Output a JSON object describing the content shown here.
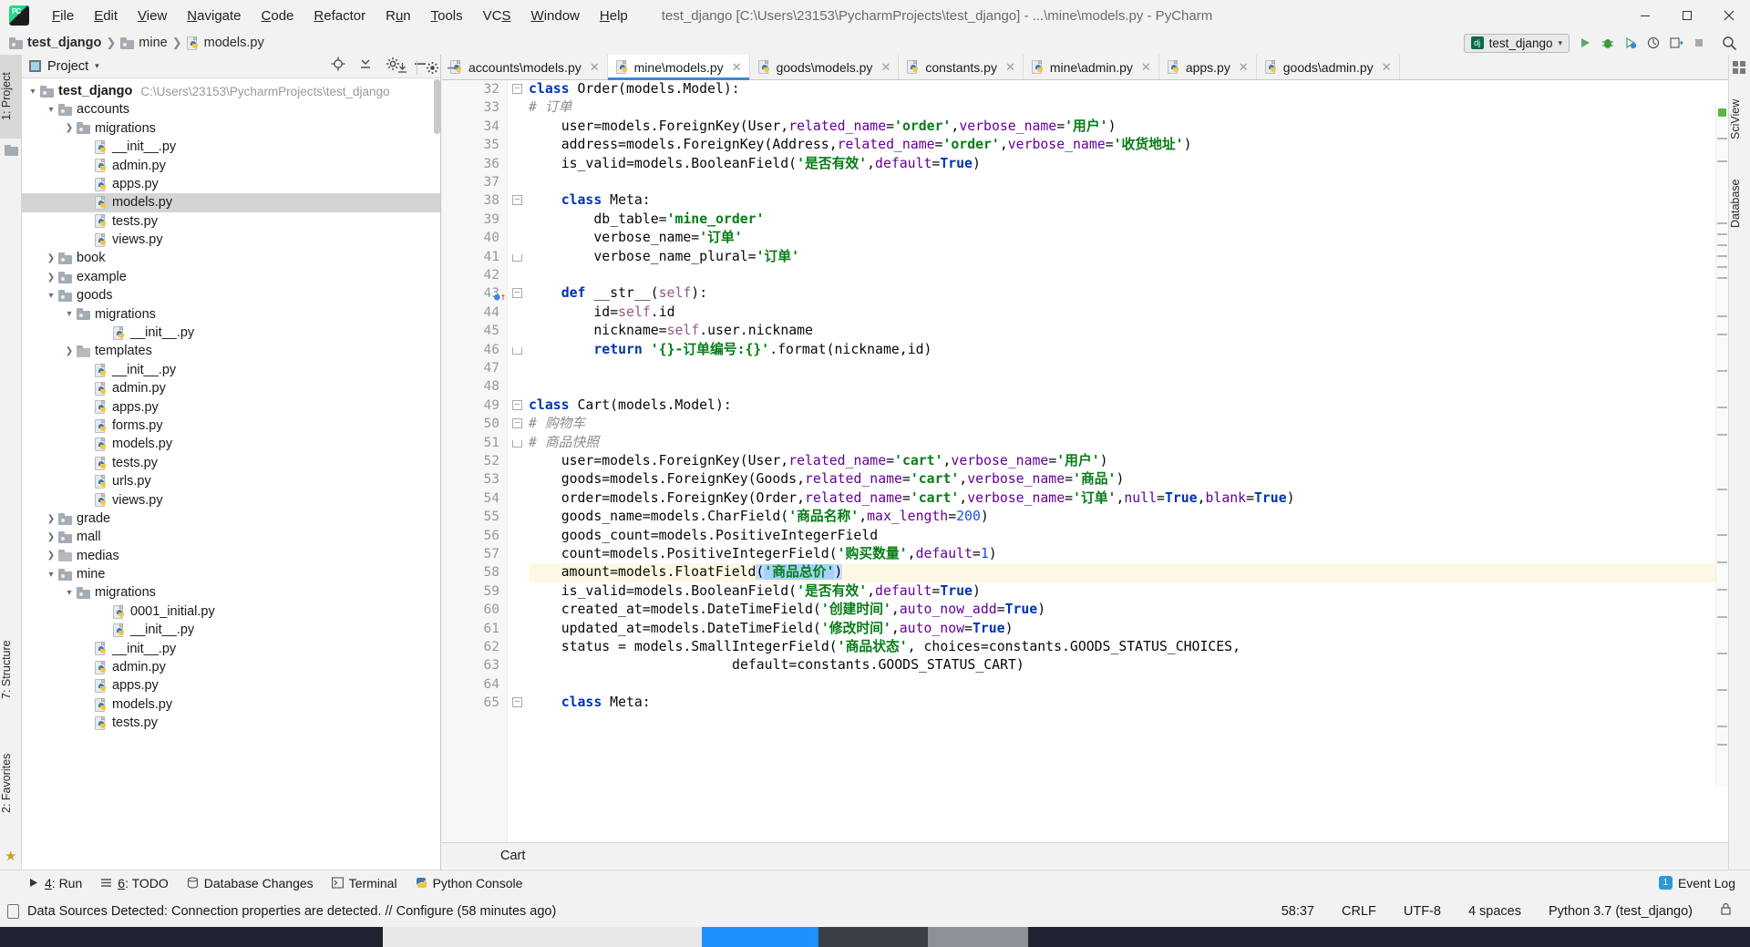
{
  "titlebar": {
    "app_icon": "pycharm-logo",
    "menus": [
      "File",
      "Edit",
      "View",
      "Navigate",
      "Code",
      "Refactor",
      "Run",
      "Tools",
      "VCS",
      "Window",
      "Help"
    ],
    "window_title": "test_django [C:\\Users\\23153\\PycharmProjects\\test_django] - ...\\mine\\models.py - PyCharm",
    "minimize": "–",
    "maximize": "❐",
    "close": "✕"
  },
  "breadcrumb": {
    "items": [
      "test_django",
      "mine",
      "models.py"
    ]
  },
  "toolbar": {
    "run_config": "test_django",
    "run": "▶",
    "debug": "debug-icon",
    "coverage": "coverage-icon",
    "profile": "profile-icon",
    "attach": "attach-icon",
    "stop": "■",
    "search": "search-icon"
  },
  "left_strip": {
    "project_tab": "1: Project",
    "structure_tab": "7: Structure",
    "favorites_tab": "2: Favorites"
  },
  "right_strip": {
    "sciview_tab": "SciView",
    "database_tab": "Database"
  },
  "project_panel": {
    "header_label": "Project",
    "header_caret": "▾",
    "icons": [
      "target-icon",
      "collapse-all-icon",
      "settings-icon",
      "hide-icon"
    ],
    "tree": [
      {
        "depth": 0,
        "arrow": "v",
        "icon": "folder",
        "label": "test_django",
        "bold": true,
        "path": "C:\\Users\\23153\\PycharmProjects\\test_django",
        "selected": false
      },
      {
        "depth": 1,
        "arrow": "v",
        "icon": "folder",
        "label": "accounts",
        "bold": false,
        "path": "",
        "selected": false
      },
      {
        "depth": 2,
        "arrow": ">",
        "icon": "folder",
        "label": "migrations",
        "bold": false,
        "path": "",
        "selected": false
      },
      {
        "depth": 3,
        "arrow": "",
        "icon": "py",
        "label": "__init__.py",
        "bold": false,
        "path": "",
        "selected": false
      },
      {
        "depth": 3,
        "arrow": "",
        "icon": "py",
        "label": "admin.py",
        "bold": false,
        "path": "",
        "selected": false
      },
      {
        "depth": 3,
        "arrow": "",
        "icon": "py",
        "label": "apps.py",
        "bold": false,
        "path": "",
        "selected": false
      },
      {
        "depth": 3,
        "arrow": "",
        "icon": "py",
        "label": "models.py",
        "bold": false,
        "path": "",
        "selected": true
      },
      {
        "depth": 3,
        "arrow": "",
        "icon": "py",
        "label": "tests.py",
        "bold": false,
        "path": "",
        "selected": false
      },
      {
        "depth": 3,
        "arrow": "",
        "icon": "py",
        "label": "views.py",
        "bold": false,
        "path": "",
        "selected": false
      },
      {
        "depth": 1,
        "arrow": ">",
        "icon": "folder",
        "label": "book",
        "bold": false,
        "path": "",
        "selected": false
      },
      {
        "depth": 1,
        "arrow": ">",
        "icon": "folder",
        "label": "example",
        "bold": false,
        "path": "",
        "selected": false
      },
      {
        "depth": 1,
        "arrow": "v",
        "icon": "folder",
        "label": "goods",
        "bold": false,
        "path": "",
        "selected": false
      },
      {
        "depth": 2,
        "arrow": "v",
        "icon": "folder",
        "label": "migrations",
        "bold": false,
        "path": "",
        "selected": false
      },
      {
        "depth": 4,
        "arrow": "",
        "icon": "py",
        "label": "__init__.py",
        "bold": false,
        "path": "",
        "selected": false
      },
      {
        "depth": 2,
        "arrow": ">",
        "icon": "folder-plain",
        "label": "templates",
        "bold": false,
        "path": "",
        "selected": false
      },
      {
        "depth": 3,
        "arrow": "",
        "icon": "py",
        "label": "__init__.py",
        "bold": false,
        "path": "",
        "selected": false
      },
      {
        "depth": 3,
        "arrow": "",
        "icon": "py",
        "label": "admin.py",
        "bold": false,
        "path": "",
        "selected": false
      },
      {
        "depth": 3,
        "arrow": "",
        "icon": "py",
        "label": "apps.py",
        "bold": false,
        "path": "",
        "selected": false
      },
      {
        "depth": 3,
        "arrow": "",
        "icon": "py",
        "label": "forms.py",
        "bold": false,
        "path": "",
        "selected": false
      },
      {
        "depth": 3,
        "arrow": "",
        "icon": "py",
        "label": "models.py",
        "bold": false,
        "path": "",
        "selected": false
      },
      {
        "depth": 3,
        "arrow": "",
        "icon": "py",
        "label": "tests.py",
        "bold": false,
        "path": "",
        "selected": false
      },
      {
        "depth": 3,
        "arrow": "",
        "icon": "py",
        "label": "urls.py",
        "bold": false,
        "path": "",
        "selected": false
      },
      {
        "depth": 3,
        "arrow": "",
        "icon": "py",
        "label": "views.py",
        "bold": false,
        "path": "",
        "selected": false
      },
      {
        "depth": 1,
        "arrow": ">",
        "icon": "folder",
        "label": "grade",
        "bold": false,
        "path": "",
        "selected": false
      },
      {
        "depth": 1,
        "arrow": ">",
        "icon": "folder",
        "label": "mall",
        "bold": false,
        "path": "",
        "selected": false
      },
      {
        "depth": 1,
        "arrow": ">",
        "icon": "folder-plain",
        "label": "medias",
        "bold": false,
        "path": "",
        "selected": false
      },
      {
        "depth": 1,
        "arrow": "v",
        "icon": "folder",
        "label": "mine",
        "bold": false,
        "path": "",
        "selected": false
      },
      {
        "depth": 2,
        "arrow": "v",
        "icon": "folder",
        "label": "migrations",
        "bold": false,
        "path": "",
        "selected": false
      },
      {
        "depth": 4,
        "arrow": "",
        "icon": "py",
        "label": "0001_initial.py",
        "bold": false,
        "path": "",
        "selected": false
      },
      {
        "depth": 4,
        "arrow": "",
        "icon": "py",
        "label": "__init__.py",
        "bold": false,
        "path": "",
        "selected": false
      },
      {
        "depth": 3,
        "arrow": "",
        "icon": "py",
        "label": "__init__.py",
        "bold": false,
        "path": "",
        "selected": false
      },
      {
        "depth": 3,
        "arrow": "",
        "icon": "py",
        "label": "admin.py",
        "bold": false,
        "path": "",
        "selected": false
      },
      {
        "depth": 3,
        "arrow": "",
        "icon": "py",
        "label": "apps.py",
        "bold": false,
        "path": "",
        "selected": false
      },
      {
        "depth": 3,
        "arrow": "",
        "icon": "py",
        "label": "models.py",
        "bold": false,
        "path": "",
        "selected": false
      },
      {
        "depth": 3,
        "arrow": "",
        "icon": "py",
        "label": "tests.py",
        "bold": false,
        "path": "",
        "selected": false
      }
    ]
  },
  "editor": {
    "tabs": [
      {
        "label": "accounts\\models.py",
        "active": false
      },
      {
        "label": "mine\\models.py",
        "active": true
      },
      {
        "label": "goods\\models.py",
        "active": false
      },
      {
        "label": "constants.py",
        "active": false
      },
      {
        "label": "mine\\admin.py",
        "active": false
      },
      {
        "label": "apps.py",
        "active": false
      },
      {
        "label": "goods\\admin.py",
        "active": false
      }
    ],
    "first_line_number": 32,
    "lines": [
      {
        "n": 32,
        "fold": "-",
        "indent": 0,
        "text": "class Order(models.Model):"
      },
      {
        "n": 33,
        "fold": "",
        "indent": 0,
        "text": "    # 订单"
      },
      {
        "n": 34,
        "fold": "",
        "indent": 0,
        "text": "    user=models.ForeignKey(User,related_name='order',verbose_name='用户')"
      },
      {
        "n": 35,
        "fold": "",
        "indent": 0,
        "text": "    address=models.ForeignKey(Address,related_name='order',verbose_name='收货地址')"
      },
      {
        "n": 36,
        "fold": "",
        "indent": 0,
        "text": "    is_valid=models.BooleanField('是否有效',default=True)"
      },
      {
        "n": 37,
        "fold": "",
        "indent": 0,
        "text": ""
      },
      {
        "n": 38,
        "fold": "-",
        "indent": 0,
        "text": "    class Meta:"
      },
      {
        "n": 39,
        "fold": "",
        "indent": 0,
        "text": "        db_table='mine_order'"
      },
      {
        "n": 40,
        "fold": "",
        "indent": 0,
        "text": "        verbose_name='订单'"
      },
      {
        "n": 41,
        "fold": "u",
        "indent": 0,
        "text": "        verbose_name_plural='订单'"
      },
      {
        "n": 42,
        "fold": "",
        "indent": 0,
        "text": ""
      },
      {
        "n": 43,
        "fold": "-",
        "indent": 0,
        "text": "    def __str__(self):"
      },
      {
        "n": 44,
        "fold": "",
        "indent": 0,
        "text": "        id=self.id"
      },
      {
        "n": 45,
        "fold": "",
        "indent": 0,
        "text": "        nickname=self.user.nickname"
      },
      {
        "n": 46,
        "fold": "u",
        "indent": 0,
        "text": "        return '{}-订单编号:{}'.format(nickname,id)"
      },
      {
        "n": 47,
        "fold": "",
        "indent": 0,
        "text": ""
      },
      {
        "n": 48,
        "fold": "",
        "indent": 0,
        "text": ""
      },
      {
        "n": 49,
        "fold": "-",
        "indent": 0,
        "text": "class Cart(models.Model):"
      },
      {
        "n": 50,
        "fold": "-",
        "indent": 0,
        "text": "    # 购物车"
      },
      {
        "n": 51,
        "fold": "u",
        "indent": 0,
        "text": "    # 商品快照"
      },
      {
        "n": 52,
        "fold": "",
        "indent": 0,
        "text": "    user=models.ForeignKey(User,related_name='cart',verbose_name='用户')"
      },
      {
        "n": 53,
        "fold": "",
        "indent": 0,
        "text": "    goods=models.ForeignKey(Goods,related_name='cart',verbose_name='商品')"
      },
      {
        "n": 54,
        "fold": "",
        "indent": 0,
        "text": "    order=models.ForeignKey(Order,related_name='cart',verbose_name='订单',null=True,blank=True)"
      },
      {
        "n": 55,
        "fold": "",
        "indent": 0,
        "text": "    goods_name=models.CharField('商品名称',max_length=200)"
      },
      {
        "n": 56,
        "fold": "",
        "indent": 0,
        "text": "    goods_count=models.PositiveIntegerField"
      },
      {
        "n": 57,
        "fold": "",
        "indent": 0,
        "text": "    count=models.PositiveIntegerField('购买数量',default=1)"
      },
      {
        "n": 58,
        "fold": "",
        "indent": 0,
        "text": "    amount=models.FloatField('商品总价')"
      },
      {
        "n": 59,
        "fold": "",
        "indent": 0,
        "text": "    is_valid=models.BooleanField('是否有效',default=True)"
      },
      {
        "n": 60,
        "fold": "",
        "indent": 0,
        "text": "    created_at=models.DateTimeField('创建时间',auto_now_add=True)"
      },
      {
        "n": 61,
        "fold": "",
        "indent": 0,
        "text": "    updated_at=models.DateTimeField('修改时间',auto_now=True)"
      },
      {
        "n": 62,
        "fold": "",
        "indent": 0,
        "text": "    status = models.SmallIntegerField('商品状态', choices=constants.GOODS_STATUS_CHOICES,"
      },
      {
        "n": 63,
        "fold": "",
        "indent": 0,
        "text": "                         default=constants.GOODS_STATUS_CART)"
      },
      {
        "n": 64,
        "fold": "",
        "indent": 0,
        "text": ""
      },
      {
        "n": 65,
        "fold": "-",
        "indent": 0,
        "text": "    class Meta:"
      }
    ],
    "highlight_line": 58,
    "bottom_breadcrumb": "Cart"
  },
  "tool_windows": {
    "items": [
      {
        "icon": "run-icon",
        "num": "4",
        "label": ": Run"
      },
      {
        "icon": "todo-icon",
        "num": "6",
        "label": ": TODO"
      },
      {
        "icon": "database-icon",
        "num": "",
        "label": "Database Changes"
      },
      {
        "icon": "terminal-icon",
        "num": "",
        "label": "Terminal"
      },
      {
        "icon": "python-icon",
        "num": "",
        "label": "Python Console"
      }
    ],
    "event_log": "Event Log",
    "event_log_badge": "1"
  },
  "statusbar": {
    "message": "Data Sources Detected: Connection properties are detected. // Configure (58 minutes ago)",
    "caret_position": "58:37",
    "line_separator": "CRLF",
    "encoding": "UTF-8",
    "indent": "4 spaces",
    "interpreter": "Python 3.7 (test_django)",
    "lock": "lock-icon"
  },
  "colors": {
    "accent_blue": "#3d87d9",
    "keyword": "#0033b3",
    "string": "#067d17",
    "kwarg": "#660099",
    "number": "#1750eb",
    "comment": "#8c8c8c",
    "self": "#94558d",
    "highlight_line_bg": "#fdf8e3",
    "selection": "#a6d2ff",
    "tree_selection": "#d4d4d4"
  }
}
